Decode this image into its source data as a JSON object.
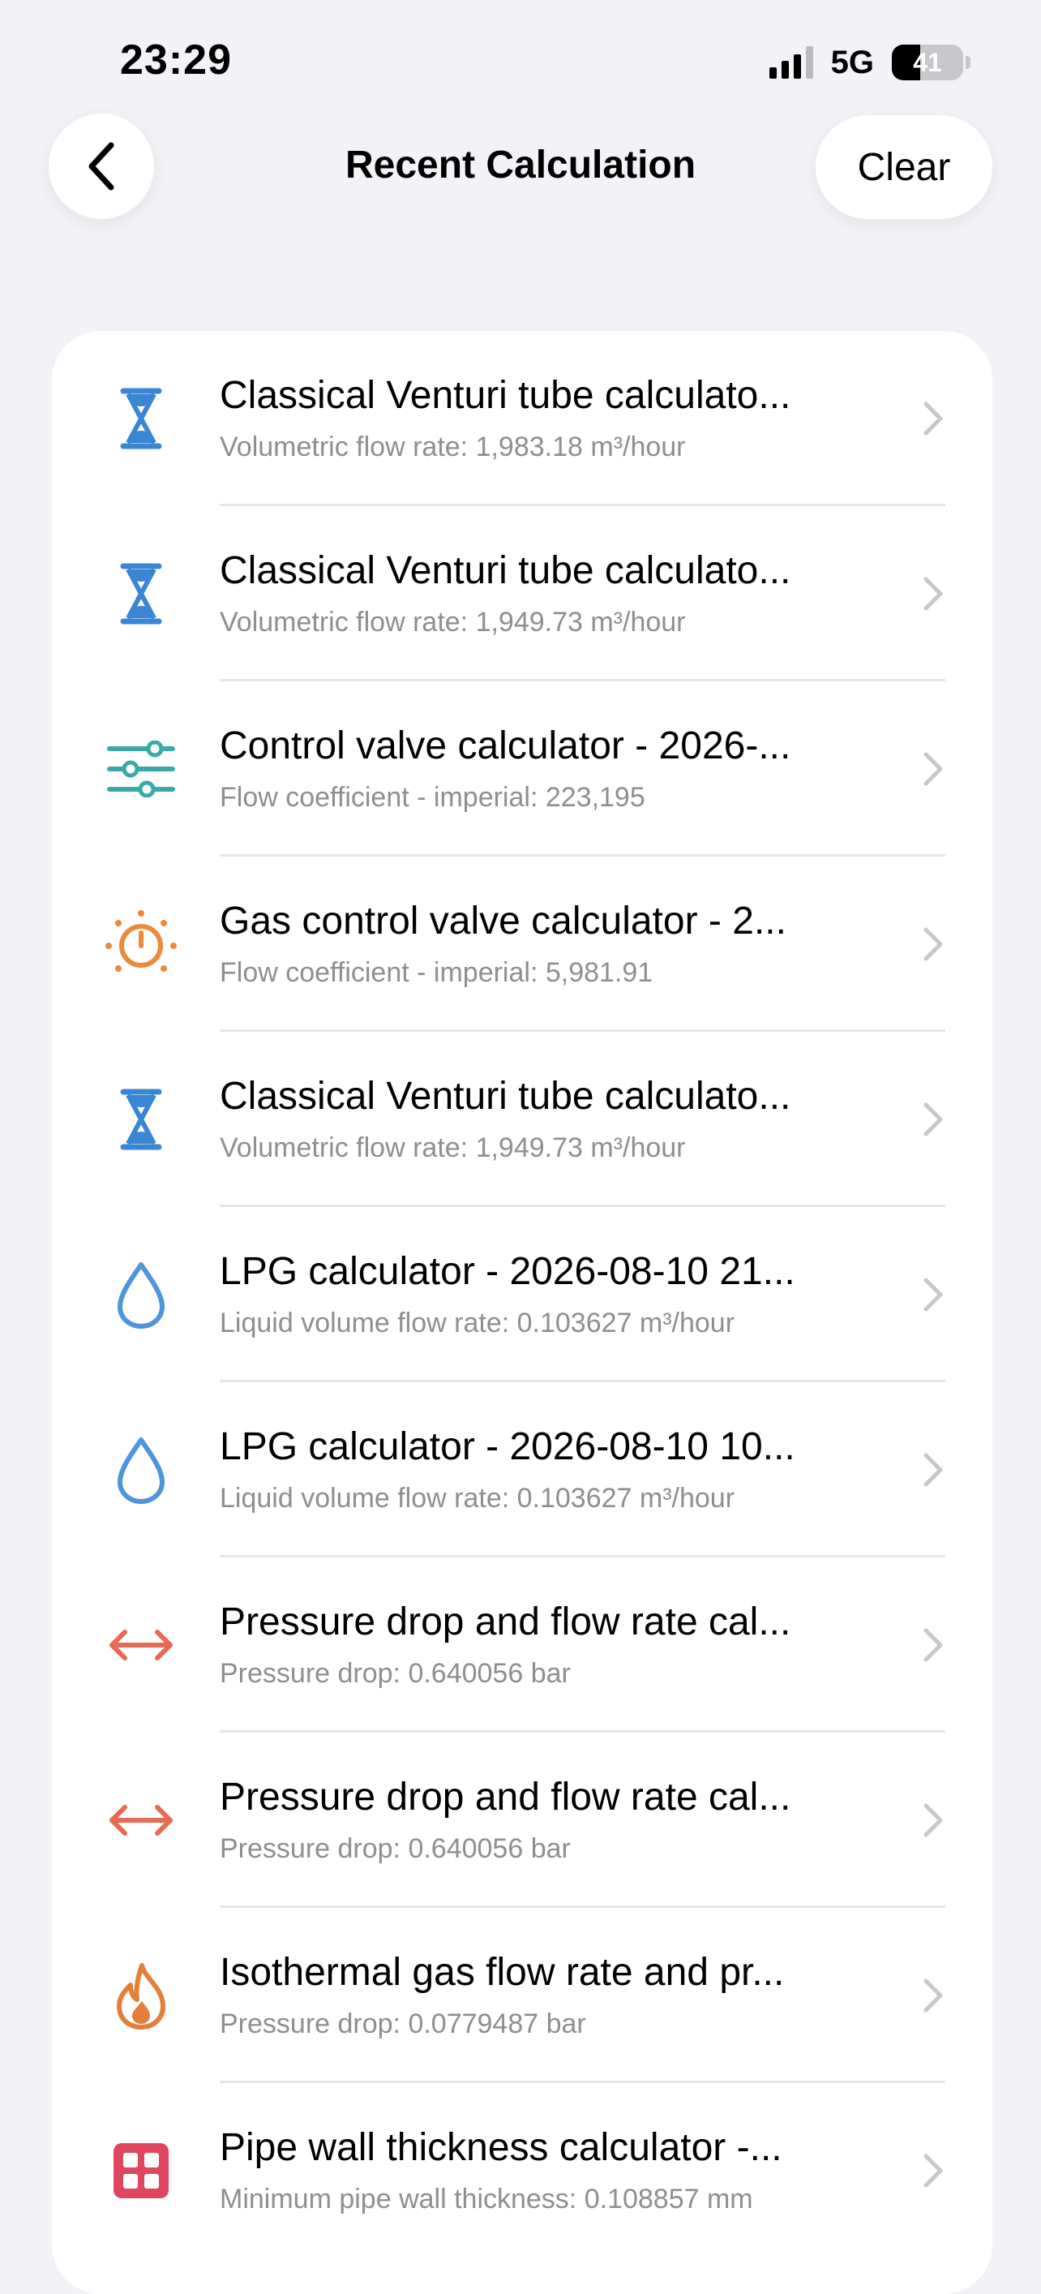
{
  "status": {
    "time": "23:29",
    "network": "5G",
    "battery": "41"
  },
  "nav": {
    "title": "Recent Calculation",
    "clear_label": "Clear"
  },
  "colors": {
    "venturi": "#3a86d4",
    "control": "#3aa8a4",
    "gas": "#ec8a3c",
    "lpg": "#4f95dc",
    "pressure": "#e66a55",
    "isothermal": "#e47f3a",
    "pipe": "#e0465f"
  },
  "items": [
    {
      "title": "Classical Venturi tube calculato...",
      "subtitle": "Volumetric flow rate: 1,983.18 m³/hour",
      "icon": "hourglass-icon"
    },
    {
      "title": "Classical Venturi tube calculato...",
      "subtitle": "Volumetric flow rate: 1,949.73 m³/hour",
      "icon": "hourglass-icon"
    },
    {
      "title": "Control valve calculator - 2026-...",
      "subtitle": "Flow coefficient - imperial: 223,195",
      "icon": "sliders-icon"
    },
    {
      "title": "Gas control valve calculator - 2...",
      "subtitle": "Flow coefficient - imperial: 5,981.91",
      "icon": "dial-icon"
    },
    {
      "title": "Classical Venturi tube calculato...",
      "subtitle": "Volumetric flow rate: 1,949.73 m³/hour",
      "icon": "hourglass-icon"
    },
    {
      "title": "LPG calculator - 2026-08-10 21...",
      "subtitle": "Liquid volume flow rate: 0.103627 m³/hour",
      "icon": "drop-icon"
    },
    {
      "title": "LPG calculator - 2026-08-10 10...",
      "subtitle": "Liquid volume flow rate: 0.103627 m³/hour",
      "icon": "drop-icon"
    },
    {
      "title": "Pressure drop and flow rate cal...",
      "subtitle": "Pressure drop: 0.640056 bar",
      "icon": "double-arrow-icon"
    },
    {
      "title": "Pressure drop and flow rate cal...",
      "subtitle": "Pressure drop: 0.640056 bar",
      "icon": "double-arrow-icon"
    },
    {
      "title": "Isothermal gas flow rate and pr...",
      "subtitle": "Pressure drop: 0.0779487 bar",
      "icon": "flame-icon"
    },
    {
      "title": "Pipe wall thickness calculator -...",
      "subtitle": "Minimum pipe wall thickness: 0.108857 mm",
      "icon": "grid-icon"
    }
  ]
}
